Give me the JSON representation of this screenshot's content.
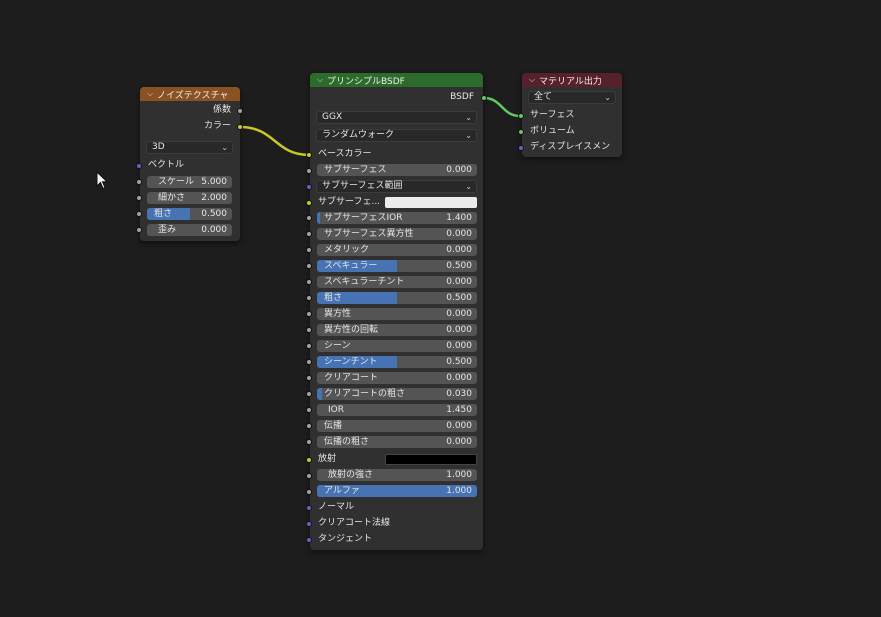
{
  "noise_node": {
    "title": "ノイズテクスチャ",
    "outputs": [
      "係数",
      "カラー"
    ],
    "dimension": "3D",
    "vector_label": "ベクトル",
    "fields": [
      {
        "label": "スケール",
        "value": "5.000",
        "fraction": 0
      },
      {
        "label": "細かさ",
        "value": "2.000",
        "fraction": 0
      },
      {
        "label": "粗さ",
        "value": "0.500",
        "fraction": 0.5
      },
      {
        "label": "歪み",
        "value": "0.000",
        "fraction": 0
      }
    ]
  },
  "bsdf_node": {
    "title": "プリンシプルBSDF",
    "output": "BSDF",
    "distribution": "GGX",
    "subsurface_method": "ランダムウォーク",
    "base_color_label": "ベースカラー",
    "subsurface_label": "サブサーフェス",
    "subsurface_value": "0.000",
    "subsurface_radius_label": "サブサーフェス範囲",
    "subsurface_color_label": "サブサーフェ...",
    "fields": [
      {
        "label": "サブサーフェスIOR",
        "value": "1.400",
        "fraction": 0.02
      },
      {
        "label": "サブサーフェス異方性",
        "value": "0.000",
        "fraction": 0
      },
      {
        "label": "メタリック",
        "value": "0.000",
        "fraction": 0
      },
      {
        "label": "スペキュラー",
        "value": "0.500",
        "fraction": 0.5
      },
      {
        "label": "スペキュラーチント",
        "value": "0.000",
        "fraction": 0
      },
      {
        "label": "粗さ",
        "value": "0.500",
        "fraction": 0.5
      },
      {
        "label": "異方性",
        "value": "0.000",
        "fraction": 0
      },
      {
        "label": "異方性の回転",
        "value": "0.000",
        "fraction": 0
      },
      {
        "label": "シーン",
        "value": "0.000",
        "fraction": 0
      },
      {
        "label": "シーンチント",
        "value": "0.500",
        "fraction": 0.5
      },
      {
        "label": "クリアコート",
        "value": "0.000",
        "fraction": 0
      },
      {
        "label": "クリアコートの粗さ",
        "value": "0.030",
        "fraction": 0.03
      },
      {
        "label": "IOR",
        "value": "1.450",
        "fraction": 0
      },
      {
        "label": "伝播",
        "value": "0.000",
        "fraction": 0
      },
      {
        "label": "伝播の粗さ",
        "value": "0.000",
        "fraction": 0
      }
    ],
    "emission_label": "放射",
    "emission_strength_label": "放射の強さ",
    "emission_strength_value": "1.000",
    "alpha_label": "アルファ",
    "alpha_value": "1.000",
    "alpha_fraction": 1.0,
    "normal_label": "ノーマル",
    "clearcoat_normal_label": "クリアコート法線",
    "tangent_label": "タンジェント"
  },
  "output_node": {
    "title": "マテリアル出力",
    "target": "全て",
    "inputs": [
      "サーフェス",
      "ボリューム",
      "ディスプレイスメン"
    ]
  },
  "colors": {
    "texture_header": "#8a5122",
    "shader_header": "#2d6b2d",
    "output_header": "#56202d",
    "value_fill": "#4772b3",
    "color_wire": "#c7c729",
    "shader_wire": "#63c763"
  }
}
